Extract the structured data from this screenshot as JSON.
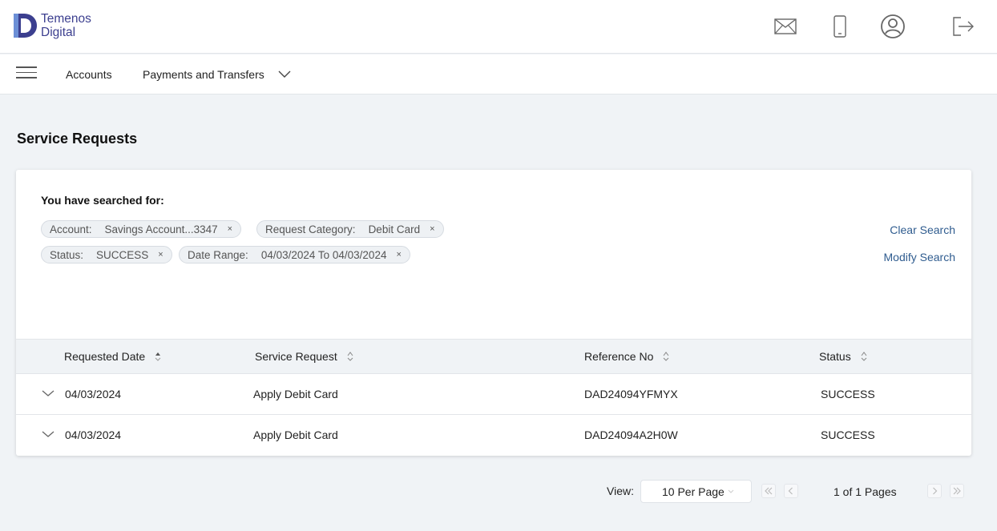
{
  "brand": {
    "line1": "Temenos",
    "line2": "Digital",
    "color": "#3c3f8f"
  },
  "header": {
    "icons": [
      "mail-icon",
      "mobile-icon",
      "profile-icon",
      "logout-icon"
    ]
  },
  "nav": {
    "items": [
      {
        "label": "Accounts"
      },
      {
        "label": "Payments and Transfers"
      }
    ]
  },
  "page": {
    "title": "Service Requests"
  },
  "search_summary": {
    "heading": "You have searched for:",
    "chips": [
      {
        "label": "Account:",
        "value": "Savings Account...3347"
      },
      {
        "label": "Request Category:",
        "value": "Debit Card"
      },
      {
        "label": "Status:",
        "value": "SUCCESS"
      },
      {
        "label": "Date Range:",
        "value": "04/03/2024 To 04/03/2024"
      }
    ],
    "remove_glyph": "×",
    "clear_label": "Clear Search",
    "modify_label": "Modify Search",
    "link_color": "#2f5c8f"
  },
  "table": {
    "columns": [
      {
        "label": "Requested Date"
      },
      {
        "label": "Service Request"
      },
      {
        "label": "Reference No"
      },
      {
        "label": "Status"
      }
    ],
    "rows": [
      {
        "date": "04/03/2024",
        "request": "Apply Debit Card",
        "reference": "DAD24094YFMYX",
        "status": "SUCCESS"
      },
      {
        "date": "04/03/2024",
        "request": "Apply Debit Card",
        "reference": "DAD24094A2H0W",
        "status": "SUCCESS"
      }
    ]
  },
  "pagination": {
    "view_label": "View:",
    "per_page": "10 Per Page",
    "info": "1 of 1 Pages"
  }
}
